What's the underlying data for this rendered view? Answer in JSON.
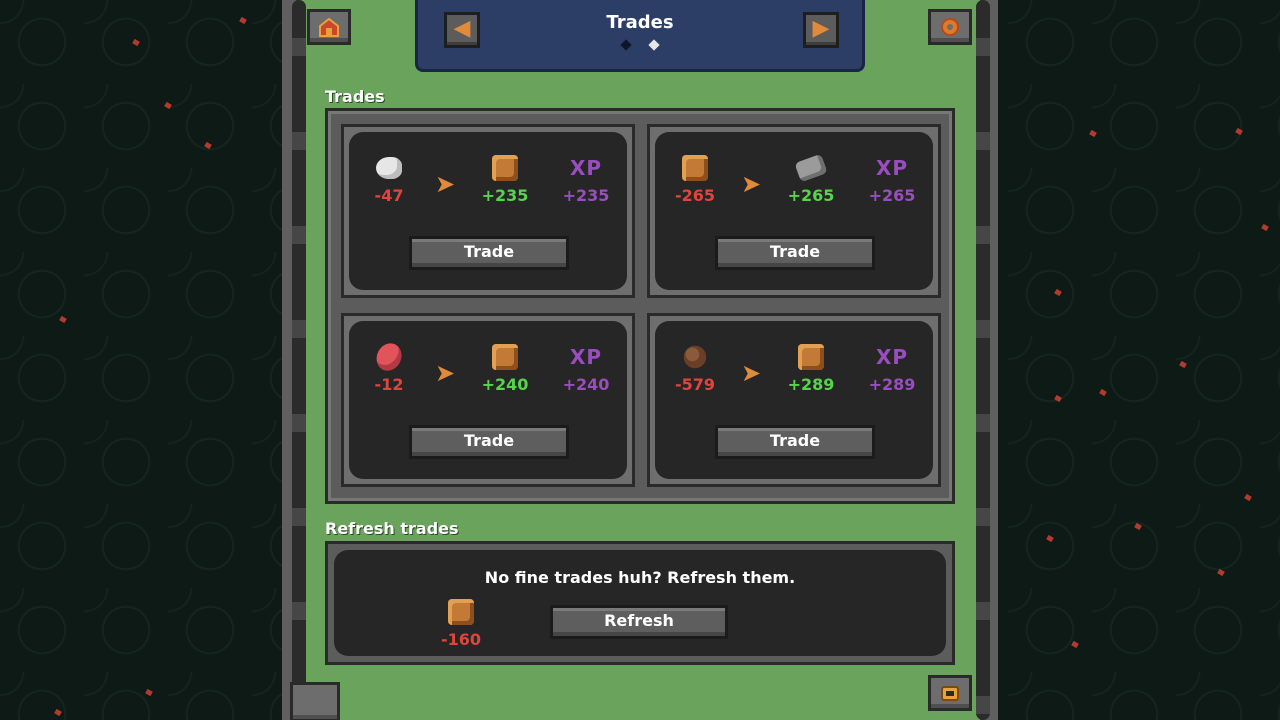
{
  "header": {
    "title": "Trades",
    "prev_symbol": "◀",
    "next_symbol": "▶",
    "pages": [
      {
        "active": false
      },
      {
        "active": true
      }
    ]
  },
  "corner_buttons": {
    "top_left_icon": "barn-icon",
    "top_right_icon": "settings-icon",
    "bottom_right_icon": "inventory-icon"
  },
  "trades_section": {
    "label": "Trades",
    "button_label": "Trade",
    "arrow_symbol": "➤",
    "xp_label": "XP",
    "cards": [
      {
        "give_icon": "duck-icon",
        "give": "-47",
        "get_icon": "cookie-icon",
        "get": "+235",
        "xp": "+235"
      },
      {
        "give_icon": "cookie-icon",
        "give": "-265",
        "get_icon": "stone-icon",
        "get": "+265",
        "xp": "+265"
      },
      {
        "give_icon": "meat-icon",
        "give": "-12",
        "get_icon": "cookie-icon",
        "get": "+240",
        "xp": "+240"
      },
      {
        "give_icon": "root-icon",
        "give": "-579",
        "get_icon": "cookie-icon",
        "get": "+289",
        "xp": "+289"
      }
    ]
  },
  "refresh_section": {
    "label": "Refresh trades",
    "message": "No fine trades huh? Refresh them.",
    "cost_icon": "cookie-icon",
    "cost": "-160",
    "button_label": "Refresh"
  },
  "colors": {
    "panel_green": "#6aa45c",
    "header_blue": "#2d3e66",
    "negative": "#e2443c",
    "positive": "#57d44c",
    "xp_purple": "#9a4dbe",
    "accent_orange": "#e08a3a"
  }
}
